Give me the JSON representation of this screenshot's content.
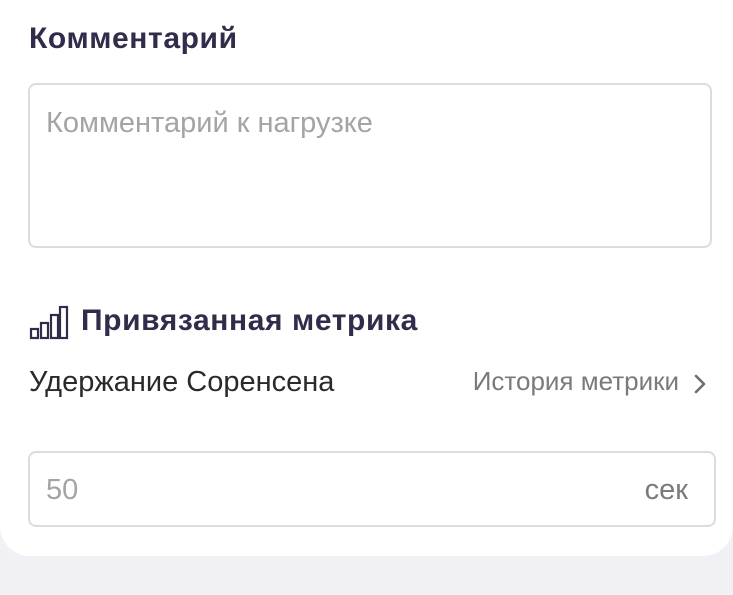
{
  "comment": {
    "title": "Комментарий",
    "placeholder": "Комментарий к нагрузке"
  },
  "metric": {
    "section_title": "Привязанная метрика",
    "icon": "bar-chart-icon",
    "name": "Удержание Соренсена",
    "history_link": "История метрики",
    "value_placeholder": "50",
    "unit": "сек"
  },
  "colors": {
    "title": "#2f2d4a",
    "placeholder": "#a4a4a4",
    "muted": "#7a7a7a",
    "border": "#dcdcdc",
    "page_bg": "#f1f1f5"
  }
}
